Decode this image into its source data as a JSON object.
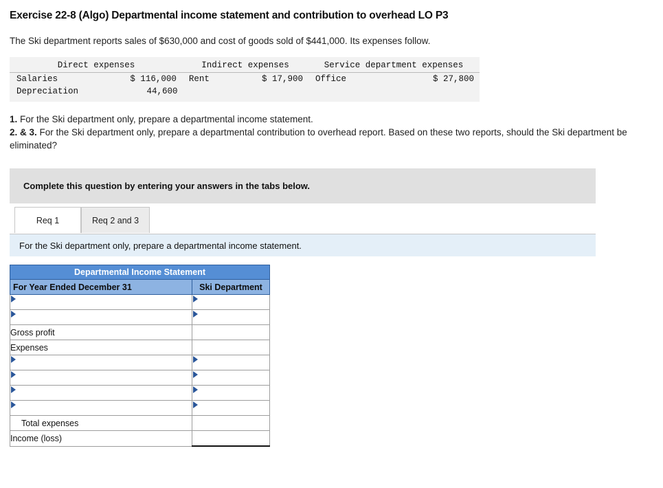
{
  "exercise": {
    "title": "Exercise 22-8 (Algo) Departmental income statement and contribution to overhead LO P3",
    "intro": "The Ski department reports sales of $630,000 and cost of goods sold of $441,000. Its expenses follow."
  },
  "expenses_table": {
    "headers": [
      "Direct expenses",
      "Indirect expenses",
      "Service department expenses"
    ],
    "rows": [
      {
        "c1_label": "Salaries",
        "c1_amount": "$ 116,000",
        "c2_label": "Rent",
        "c2_amount": "$ 17,900",
        "c3_label": "Office",
        "c3_amount": "$ 27,800"
      },
      {
        "c1_label": "Depreciation",
        "c1_amount": "44,600",
        "c2_label": "",
        "c2_amount": "",
        "c3_label": "",
        "c3_amount": ""
      }
    ]
  },
  "requirements": {
    "req1_number": "1.",
    "req1_text": " For the Ski department only, prepare a departmental income statement.",
    "req23_number": "2. & 3.",
    "req23_text": " For the Ski department only, prepare a departmental contribution to overhead report. Based on these two reports, should the Ski department be eliminated?"
  },
  "banner": {
    "text": "Complete this question by entering your answers in the tabs below."
  },
  "tabs": [
    {
      "label": "Req 1",
      "active": true
    },
    {
      "label": "Req 2 and 3",
      "active": false
    }
  ],
  "sub_banner": {
    "text": "For the Ski department only, prepare a departmental income statement."
  },
  "statement": {
    "title": "Departmental Income Statement",
    "col_header_left": "For Year Ended December 31",
    "col_header_right": "Ski Department",
    "rows": [
      {
        "label": "",
        "type": "input",
        "value": ""
      },
      {
        "label": "",
        "type": "input",
        "value": ""
      },
      {
        "label": "Gross profit",
        "type": "static",
        "value": ""
      },
      {
        "label": "Expenses",
        "type": "static",
        "value": ""
      },
      {
        "label": "",
        "type": "input",
        "value": ""
      },
      {
        "label": "",
        "type": "input",
        "value": ""
      },
      {
        "label": "",
        "type": "input",
        "value": ""
      },
      {
        "label": "",
        "type": "input",
        "value": ""
      },
      {
        "label": "Total expenses",
        "type": "total",
        "value": ""
      },
      {
        "label": "Income (loss)",
        "type": "final",
        "value": ""
      }
    ]
  },
  "colors": {
    "header_blue": "#558ed5",
    "subheader_blue": "#8db3e2",
    "banner_gray": "#e0e0e0",
    "sub_banner_blue": "#e4eff8",
    "marker_blue": "#2a5699"
  }
}
